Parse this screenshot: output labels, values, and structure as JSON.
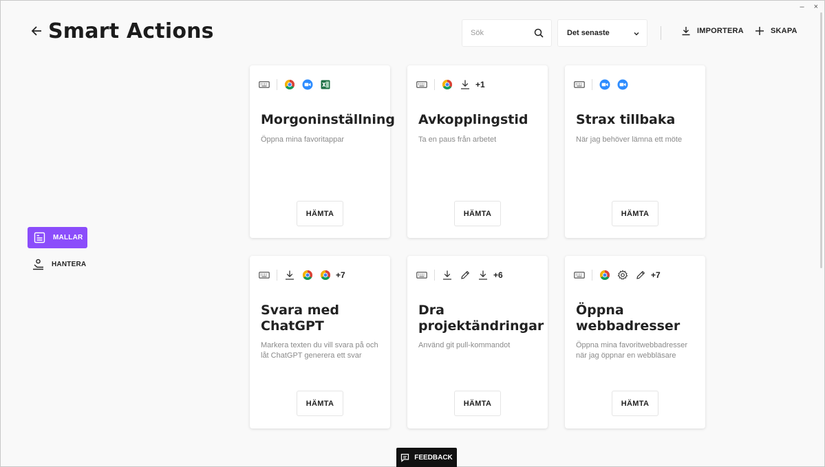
{
  "window": {
    "minimize_glyph": "–",
    "close_glyph": "×"
  },
  "header": {
    "title": "Smart Actions",
    "back_icon": "arrow-left-icon",
    "search": {
      "placeholder": "Sök",
      "value": ""
    },
    "sort": {
      "selected": "Det senaste"
    },
    "import_label": "IMPORTERA",
    "create_label": "SKAPA"
  },
  "sidebar": {
    "items": [
      {
        "label": "MALLAR",
        "icon": "template-icon",
        "active": true
      },
      {
        "label": "HANTERA",
        "icon": "manage-icon",
        "active": false
      }
    ]
  },
  "cards": [
    {
      "title": "Morgoninställning",
      "desc": "Öppna mina favoritappar",
      "button": "HÄMTA",
      "icons": [
        "keyboard-icon",
        "chrome-icon",
        "zoom-icon",
        "excel-icon"
      ],
      "more": ""
    },
    {
      "title": "Avkopplingstid",
      "desc": "Ta en paus från arbetet",
      "button": "HÄMTA",
      "icons": [
        "keyboard-icon",
        "chrome-icon",
        "download-icon"
      ],
      "more": "+1"
    },
    {
      "title": "Strax tillbaka",
      "desc": "När jag behöver lämna ett möte",
      "button": "HÄMTA",
      "icons": [
        "keyboard-icon",
        "zoom-icon",
        "zoom-icon"
      ],
      "more": ""
    },
    {
      "title": "Svara med ChatGPT",
      "desc": "Markera texten du vill svara på och låt ChatGPT generera ett svar",
      "button": "HÄMTA",
      "icons": [
        "keyboard-icon",
        "download-icon",
        "chrome-icon",
        "chrome-icon"
      ],
      "more": "+7"
    },
    {
      "title": "Dra projektändringar",
      "desc": "Använd git pull-kommandot",
      "button": "HÄMTA",
      "icons": [
        "keyboard-icon",
        "download-icon",
        "pencil-icon",
        "download-icon"
      ],
      "more": "+6"
    },
    {
      "title": "Öppna webbadresser",
      "desc": "Öppna mina favoritwebbadresser när jag öppnar en webbläsare",
      "button": "HÄMTA",
      "icons": [
        "keyboard-icon",
        "chrome-icon",
        "gear-icon",
        "pencil-icon"
      ],
      "more": "+7"
    }
  ],
  "feedback_label": "FEEDBACK",
  "colors": {
    "accent": "#8b4dfb",
    "zoom": "#2d8cff",
    "excel": "#1d7044"
  }
}
